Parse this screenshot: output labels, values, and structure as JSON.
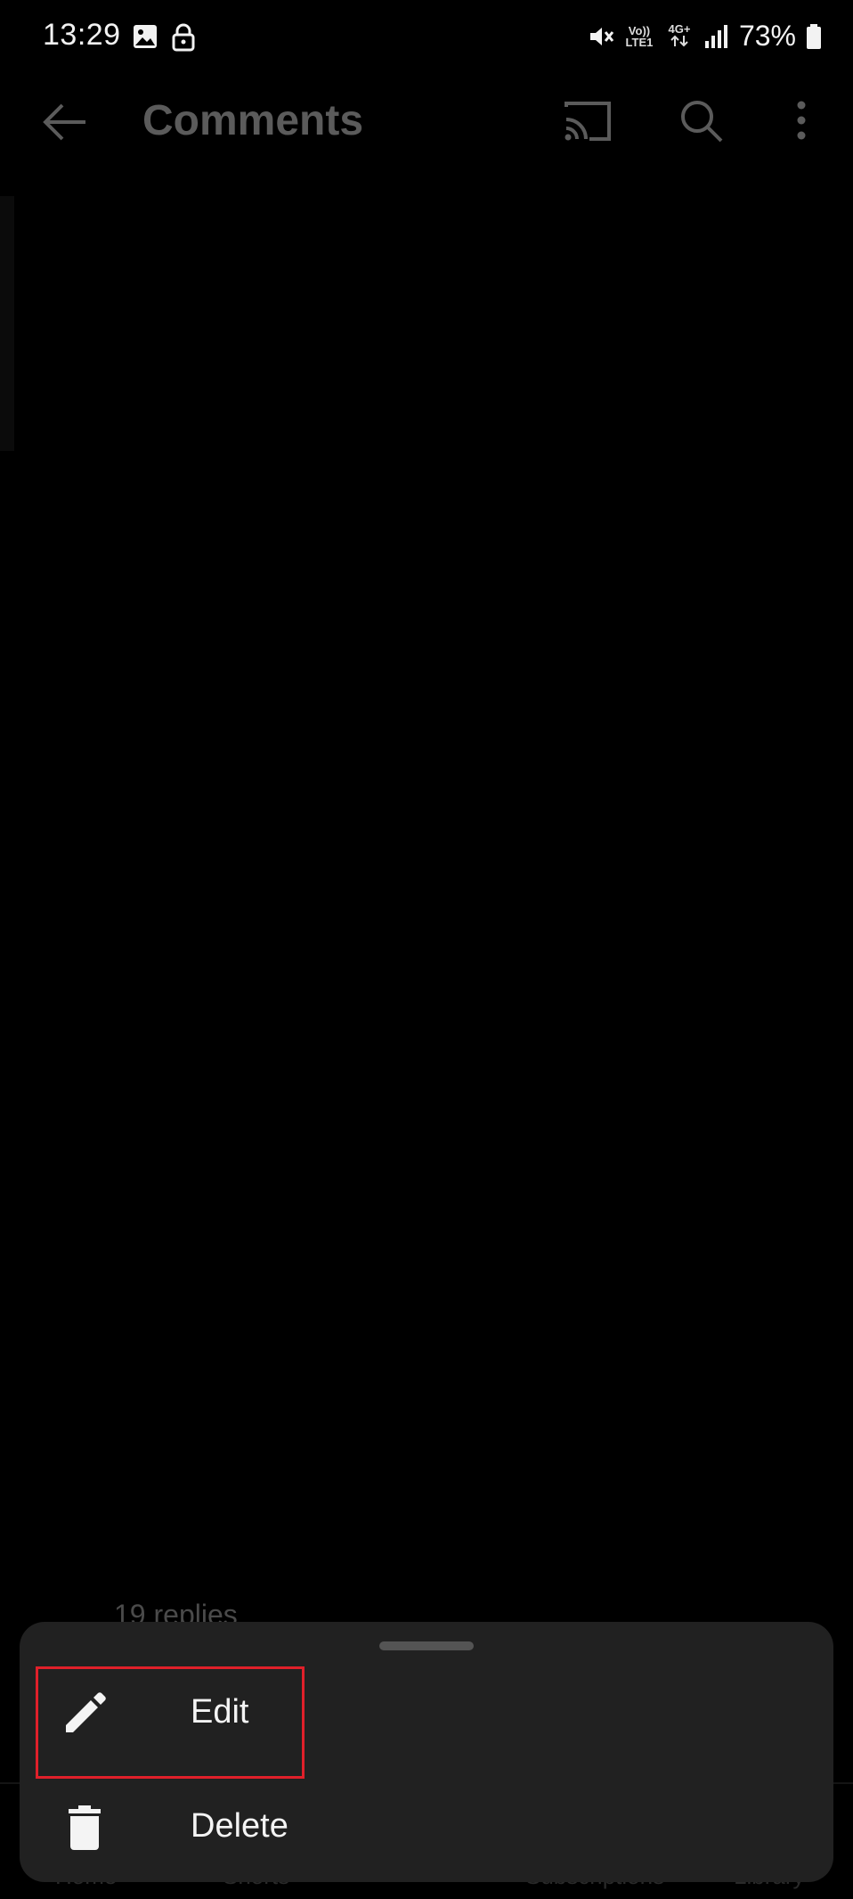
{
  "status_bar": {
    "time": "13:29",
    "volte": "Vo)) LTE1",
    "network": "4G+",
    "battery": "73%"
  },
  "app_bar": {
    "title": "Comments"
  },
  "background": {
    "replies_text": "19 replies",
    "nav_labels": [
      "Home",
      "Shorts",
      "Subscriptions",
      "Library"
    ]
  },
  "menu": {
    "items": [
      {
        "label": "Edit",
        "icon": "pencil-icon"
      },
      {
        "label": "Delete",
        "icon": "trash-icon"
      }
    ],
    "highlight_color": "#e0202a"
  },
  "colors": {
    "background": "#000000",
    "sheet": "#212121",
    "title": "#5b5b5b"
  }
}
